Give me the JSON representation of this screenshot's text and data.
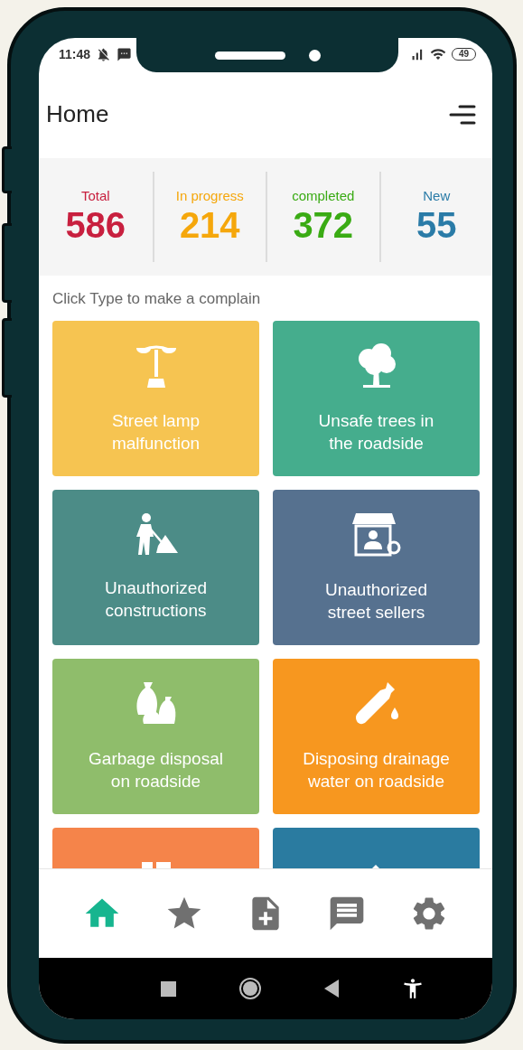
{
  "status_bar": {
    "time": "11:48",
    "battery": "49"
  },
  "header": {
    "title": "Home"
  },
  "stats": [
    {
      "label": "Total",
      "value": "586",
      "color": "#c8203f"
    },
    {
      "label": "In progress",
      "value": "214",
      "color": "#f5a70c"
    },
    {
      "label": "completed",
      "value": "372",
      "color": "#3aab14"
    },
    {
      "label": "New",
      "value": "55",
      "color": "#2a7ba7"
    }
  ],
  "prompt": "Click Type to make a complain",
  "complaint_types": [
    {
      "label": "Street lamp\nmalfunction",
      "kind": "lamp",
      "color": "#f6c451"
    },
    {
      "label": "Unsafe trees in\nthe roadside",
      "kind": "tree",
      "color": "#45ad8d"
    },
    {
      "label": "Unauthorized\nconstructions",
      "kind": "worker",
      "color": "#4c8c87"
    },
    {
      "label": "Unauthorized\nstreet sellers",
      "kind": "stall",
      "color": "#56718f"
    },
    {
      "label": "Garbage disposal\non roadside",
      "kind": "garbage",
      "color": "#8fbd6b"
    },
    {
      "label": "Disposing drainage\nwater on roadside",
      "kind": "bottle",
      "color": "#f7971f"
    },
    {
      "kind": "buildings",
      "color": "#f5844a"
    },
    {
      "kind": "hammer",
      "color": "#2a7ba0"
    }
  ],
  "bottom_nav": [
    {
      "kind": "home",
      "selected": true
    },
    {
      "kind": "star",
      "selected": false
    },
    {
      "kind": "add_file",
      "selected": false
    },
    {
      "kind": "message",
      "selected": false
    },
    {
      "kind": "settings",
      "selected": false
    }
  ]
}
